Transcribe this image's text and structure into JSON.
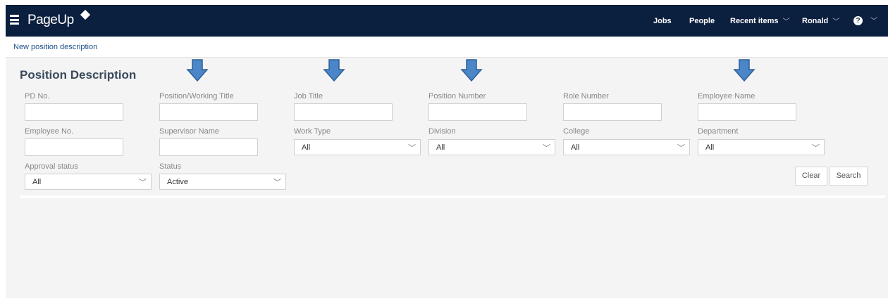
{
  "nav": {
    "logo": "PageUp",
    "jobs": "Jobs",
    "people": "People",
    "recent": "Recent items",
    "user": "Ronald",
    "help": "?"
  },
  "breadcrumb": {
    "new_pd": "New position description"
  },
  "page": {
    "title": "Position Description"
  },
  "fields": {
    "pd_no": "PD No.",
    "position_title": "Position/Working Title",
    "job_title": "Job Title",
    "position_number": "Position Number",
    "role_number": "Role Number",
    "employee_name": "Employee Name",
    "employee_no": "Employee No.",
    "supervisor_name": "Supervisor Name",
    "work_type": "Work Type",
    "division": "Division",
    "college": "College",
    "department": "Department",
    "approval_status": "Approval status",
    "status": "Status"
  },
  "selects": {
    "work_type": "All",
    "division": "All",
    "college": "All",
    "department": "All",
    "approval_status": "All",
    "status": "Active"
  },
  "buttons": {
    "clear": "Clear",
    "search": "Search"
  },
  "colors": {
    "topbar": "#0b1f3f",
    "arrow": "#4a86c8",
    "link": "#1a4f8b"
  }
}
